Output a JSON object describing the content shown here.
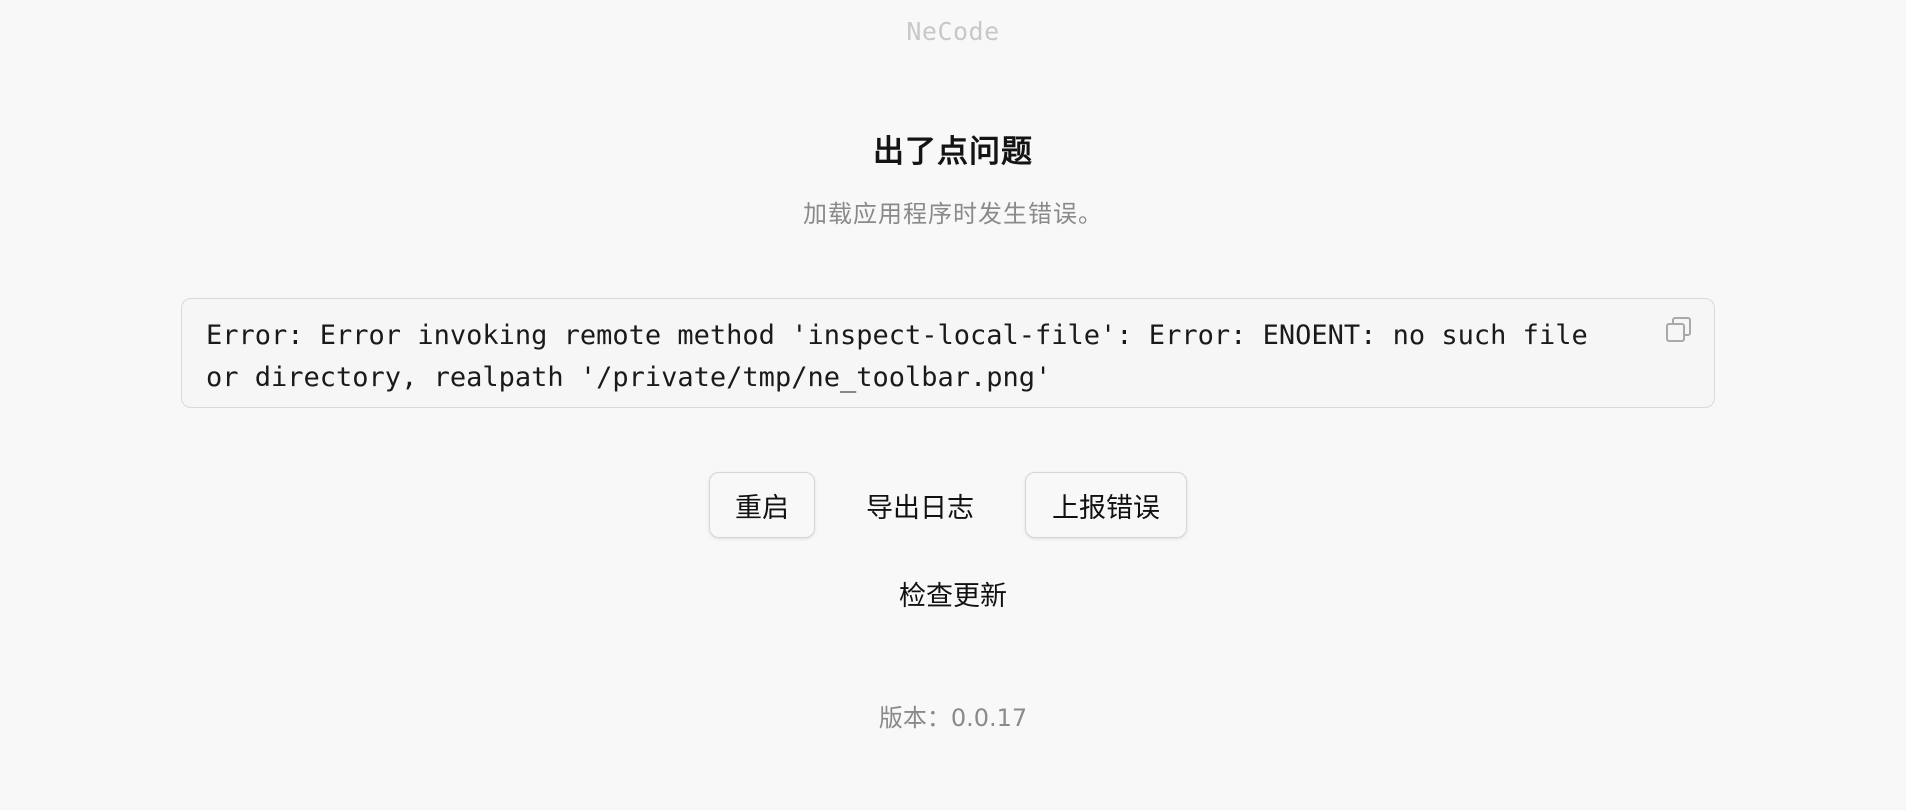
{
  "app": {
    "name": "NeCode"
  },
  "error_page": {
    "title": "出了点问题",
    "subtitle": "加载应用程序时发生错误。",
    "error_message": "Error: Error invoking remote method 'inspect-local-file': Error: ENOENT: no such file or directory, realpath '/private/tmp/ne_toolbar.png'",
    "copy_icon": "copy-icon"
  },
  "actions": {
    "restart_label": "重启",
    "export_logs_label": "导出日志",
    "report_error_label": "上报错误",
    "check_update_label": "检查更新"
  },
  "footer": {
    "version_text": "版本：0.0.17"
  },
  "colors": {
    "background": "#f8f8f8",
    "muted_text": "#8a8a8a",
    "border": "#d9d9d9"
  }
}
